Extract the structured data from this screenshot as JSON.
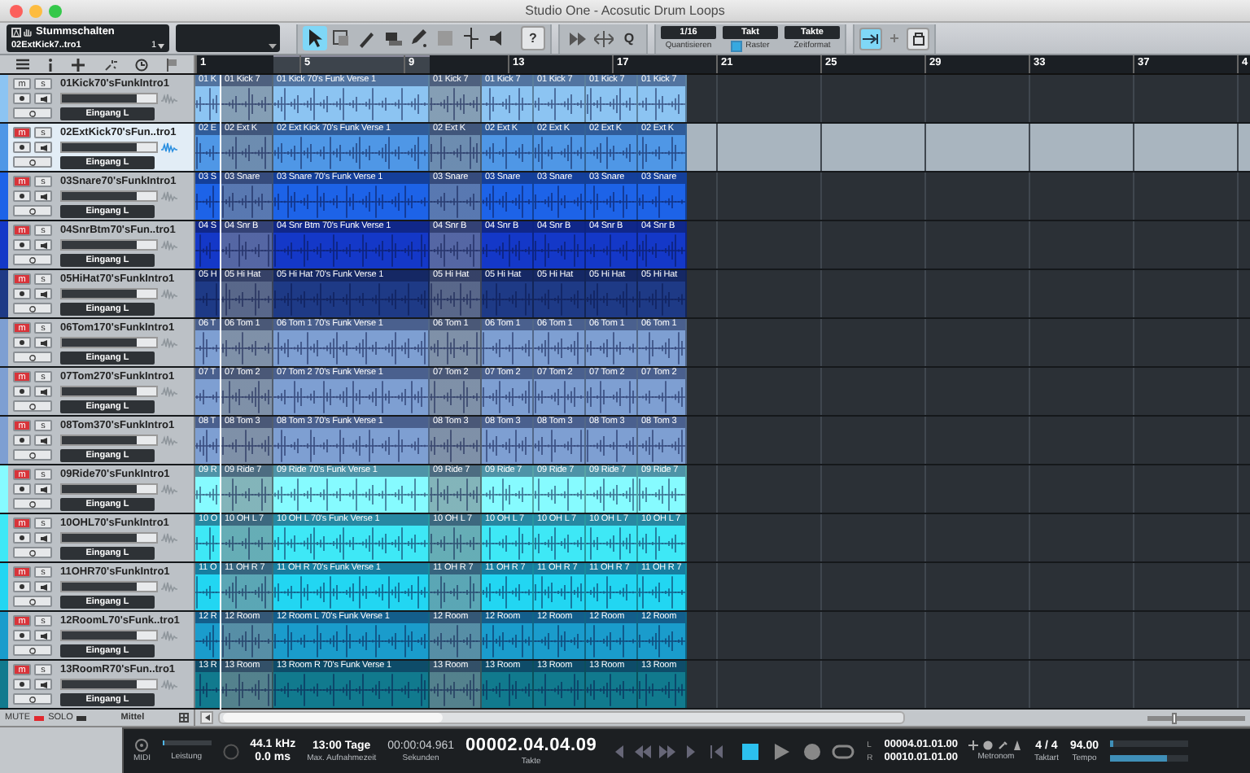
{
  "window": {
    "title": "Studio One - Acosutic Drum Loops"
  },
  "toolbar": {
    "track_panel": {
      "title": "Stummschalten",
      "track": "02ExtKick7..tro1",
      "number": "1"
    },
    "tools": [
      {
        "kind": "arrow",
        "selected": true
      },
      {
        "kind": "range",
        "selected": false
      },
      {
        "kind": "split",
        "selected": false
      },
      {
        "kind": "eraser",
        "selected": false
      },
      {
        "kind": "pencil",
        "selected": false
      },
      {
        "kind": "mute",
        "selected": false
      },
      {
        "kind": "bend",
        "selected": false
      },
      {
        "kind": "listen",
        "selected": false
      }
    ],
    "help_button": "?",
    "quantize_button": "Q",
    "quantize": {
      "value": "1/16",
      "label": "Quantisieren"
    },
    "timebase": {
      "value": "Takt",
      "label": "Raster",
      "checked": true
    },
    "timeformat": {
      "value": "Takte",
      "label": "Zeitformat"
    },
    "autoscroll": {
      "on": true
    }
  },
  "ruler": {
    "bars": [
      "1",
      "5",
      "9",
      "13",
      "17",
      "21",
      "25",
      "29",
      "33",
      "37",
      "4"
    ]
  },
  "tracks": [
    {
      "name": "01Kick70'sFunkIntro1",
      "color": "#8cc4f2",
      "muted": false,
      "selected": false,
      "mute_button": "m",
      "solo_button": "s",
      "level": 0.8,
      "input": "Eingang L",
      "clips": [
        {
          "label": "01 K",
          "dimmed": false
        },
        {
          "label": "01 Kick 7",
          "dimmed": true
        },
        {
          "label": "01 Kick 70's Funk Verse 1",
          "dimmed": false
        },
        {
          "label": "01 Kick 7",
          "dimmed": true
        },
        {
          "label": "01 Kick 7",
          "dimmed": false
        },
        {
          "label": "01 Kick 7",
          "dimmed": false
        },
        {
          "label": "01 Kick 7",
          "dimmed": false
        },
        {
          "label": "01 Kick 7",
          "dimmed": false
        }
      ]
    },
    {
      "name": "02ExtKick70'sFun..tro1",
      "color": "#4f97e6",
      "muted": true,
      "selected": true,
      "mute_button": "m",
      "solo_button": "s",
      "level": 0.8,
      "input": "Eingang L",
      "clips": [
        {
          "label": "02 E",
          "dimmed": false
        },
        {
          "label": "02 Ext K",
          "dimmed": true
        },
        {
          "label": "02 Ext Kick 70's Funk Verse 1",
          "dimmed": false
        },
        {
          "label": "02 Ext K",
          "dimmed": true
        },
        {
          "label": "02 Ext K",
          "dimmed": false
        },
        {
          "label": "02 Ext K",
          "dimmed": false
        },
        {
          "label": "02 Ext K",
          "dimmed": false
        },
        {
          "label": "02 Ext K",
          "dimmed": false
        }
      ]
    },
    {
      "name": "03Snare70'sFunkIntro1",
      "color": "#1d63e8",
      "muted": true,
      "selected": false,
      "mute_button": "m",
      "solo_button": "s",
      "level": 0.8,
      "input": "Eingang L",
      "clips": [
        {
          "label": "03 S",
          "dimmed": false
        },
        {
          "label": "03 Snare",
          "dimmed": true
        },
        {
          "label": "03 Snare 70's Funk Verse 1",
          "dimmed": false
        },
        {
          "label": "03 Snare",
          "dimmed": true
        },
        {
          "label": "03 Snare",
          "dimmed": false
        },
        {
          "label": "03 Snare",
          "dimmed": false
        },
        {
          "label": "03 Snare",
          "dimmed": false
        },
        {
          "label": "03 Snare",
          "dimmed": false
        }
      ]
    },
    {
      "name": "04SnrBtm70'sFun..tro1",
      "color": "#1438c8",
      "muted": true,
      "selected": false,
      "mute_button": "m",
      "solo_button": "s",
      "level": 0.8,
      "input": "Eingang L",
      "clips": [
        {
          "label": "04 S",
          "dimmed": false
        },
        {
          "label": "04 Snr B",
          "dimmed": true
        },
        {
          "label": "04 Snr Btm 70's Funk Verse 1",
          "dimmed": false
        },
        {
          "label": "04 Snr B",
          "dimmed": true
        },
        {
          "label": "04 Snr B",
          "dimmed": false
        },
        {
          "label": "04 Snr B",
          "dimmed": false
        },
        {
          "label": "04 Snr B",
          "dimmed": false
        },
        {
          "label": "04 Snr B",
          "dimmed": false
        }
      ]
    },
    {
      "name": "05HiHat70'sFunkIntro1",
      "color": "#1e3a86",
      "muted": true,
      "selected": false,
      "mute_button": "m",
      "solo_button": "s",
      "level": 0.8,
      "input": "Eingang L",
      "clips": [
        {
          "label": "05 H",
          "dimmed": false
        },
        {
          "label": "05 Hi Hat",
          "dimmed": true
        },
        {
          "label": "05 Hi Hat 70's Funk Verse 1",
          "dimmed": false
        },
        {
          "label": "05 Hi Hat",
          "dimmed": true
        },
        {
          "label": "05 Hi Hat",
          "dimmed": false
        },
        {
          "label": "05 Hi Hat",
          "dimmed": false
        },
        {
          "label": "05 Hi Hat",
          "dimmed": false
        },
        {
          "label": "05 Hi Hat",
          "dimmed": false
        }
      ]
    },
    {
      "name": "06Tom170'sFunkIntro1",
      "color": "#7e9fd2",
      "muted": true,
      "selected": false,
      "mute_button": "m",
      "solo_button": "s",
      "level": 0.8,
      "input": "Eingang L",
      "clips": [
        {
          "label": "06 T",
          "dimmed": false
        },
        {
          "label": "06 Tom 1",
          "dimmed": true
        },
        {
          "label": "06 Tom 1 70's Funk Verse 1",
          "dimmed": false
        },
        {
          "label": "06 Tom 1",
          "dimmed": true
        },
        {
          "label": "06 Tom 1",
          "dimmed": false
        },
        {
          "label": "06 Tom 1",
          "dimmed": false
        },
        {
          "label": "06 Tom 1",
          "dimmed": false
        },
        {
          "label": "06 Tom 1",
          "dimmed": false
        }
      ]
    },
    {
      "name": "07Tom270'sFunkIntro1",
      "color": "#7e9fd2",
      "muted": true,
      "selected": false,
      "mute_button": "m",
      "solo_button": "s",
      "level": 0.8,
      "input": "Eingang L",
      "clips": [
        {
          "label": "07 T",
          "dimmed": false
        },
        {
          "label": "07 Tom 2",
          "dimmed": true
        },
        {
          "label": "07 Tom 2 70's Funk Verse 1",
          "dimmed": false
        },
        {
          "label": "07 Tom 2",
          "dimmed": true
        },
        {
          "label": "07 Tom 2",
          "dimmed": false
        },
        {
          "label": "07 Tom 2",
          "dimmed": false
        },
        {
          "label": "07 Tom 2",
          "dimmed": false
        },
        {
          "label": "07 Tom 2",
          "dimmed": false
        }
      ]
    },
    {
      "name": "08Tom370'sFunkIntro1",
      "color": "#7e9fd2",
      "muted": true,
      "selected": false,
      "mute_button": "m",
      "solo_button": "s",
      "level": 0.8,
      "input": "Eingang L",
      "clips": [
        {
          "label": "08 T",
          "dimmed": false
        },
        {
          "label": "08 Tom 3",
          "dimmed": true
        },
        {
          "label": "08 Tom 3 70's Funk Verse 1",
          "dimmed": false
        },
        {
          "label": "08 Tom 3",
          "dimmed": true
        },
        {
          "label": "08 Tom 3",
          "dimmed": false
        },
        {
          "label": "08 Tom 3",
          "dimmed": false
        },
        {
          "label": "08 Tom 3",
          "dimmed": false
        },
        {
          "label": "08 Tom 3",
          "dimmed": false
        }
      ]
    },
    {
      "name": "09Ride70'sFunkIntro1",
      "color": "#86fbff",
      "muted": true,
      "selected": false,
      "mute_button": "m",
      "solo_button": "s",
      "level": 0.8,
      "input": "Eingang L",
      "clips": [
        {
          "label": "09 R",
          "dimmed": false
        },
        {
          "label": "09 Ride 7",
          "dimmed": true
        },
        {
          "label": "09 Ride 70's Funk Verse 1",
          "dimmed": false
        },
        {
          "label": "09 Ride 7",
          "dimmed": true
        },
        {
          "label": "09 Ride 7",
          "dimmed": false
        },
        {
          "label": "09 Ride 7",
          "dimmed": false
        },
        {
          "label": "09 Ride 7",
          "dimmed": false
        },
        {
          "label": "09 Ride 7",
          "dimmed": false
        }
      ]
    },
    {
      "name": "10OHL70'sFunkIntro1",
      "color": "#3ee8f6",
      "muted": true,
      "selected": false,
      "mute_button": "m",
      "solo_button": "s",
      "level": 0.8,
      "input": "Eingang L",
      "clips": [
        {
          "label": "10 O",
          "dimmed": false
        },
        {
          "label": "10 OH L 7",
          "dimmed": true
        },
        {
          "label": "10 OH L 70's Funk Verse 1",
          "dimmed": false
        },
        {
          "label": "10 OH L 7",
          "dimmed": true
        },
        {
          "label": "10 OH L 7",
          "dimmed": false
        },
        {
          "label": "10 OH L 7",
          "dimmed": false
        },
        {
          "label": "10 OH L 7",
          "dimmed": false
        },
        {
          "label": "10 OH L 7",
          "dimmed": false
        }
      ]
    },
    {
      "name": "11OHR70'sFunkIntro1",
      "color": "#22d6f2",
      "muted": true,
      "selected": false,
      "mute_button": "m",
      "solo_button": "s",
      "level": 0.8,
      "input": "Eingang L",
      "clips": [
        {
          "label": "11 O",
          "dimmed": false
        },
        {
          "label": "11 OH R 7",
          "dimmed": true
        },
        {
          "label": "11 OH R 70's Funk Verse 1",
          "dimmed": false
        },
        {
          "label": "11 OH R 7",
          "dimmed": true
        },
        {
          "label": "11 OH R 7",
          "dimmed": false
        },
        {
          "label": "11 OH R 7",
          "dimmed": false
        },
        {
          "label": "11 OH R 7",
          "dimmed": false
        },
        {
          "label": "11 OH R 7",
          "dimmed": false
        }
      ]
    },
    {
      "name": "12RoomL70'sFunk..tro1",
      "color": "#1a9ccc",
      "muted": true,
      "selected": false,
      "mute_button": "m",
      "solo_button": "s",
      "level": 0.8,
      "input": "Eingang L",
      "clips": [
        {
          "label": "12 R",
          "dimmed": false
        },
        {
          "label": "12 Room",
          "dimmed": true
        },
        {
          "label": "12 Room L 70's Funk Verse 1",
          "dimmed": false
        },
        {
          "label": "12 Room",
          "dimmed": true
        },
        {
          "label": "12 Room",
          "dimmed": false
        },
        {
          "label": "12 Room",
          "dimmed": false
        },
        {
          "label": "12 Room",
          "dimmed": false
        },
        {
          "label": "12 Room",
          "dimmed": false
        }
      ]
    },
    {
      "name": "13RoomR70'sFun..tro1",
      "color": "#117a8e",
      "muted": true,
      "selected": false,
      "mute_button": "m",
      "solo_button": "s",
      "level": 0.8,
      "input": "Eingang L",
      "clips": [
        {
          "label": "13 R",
          "dimmed": false
        },
        {
          "label": "13 Room",
          "dimmed": true
        },
        {
          "label": "13 Room R 70's Funk Verse 1",
          "dimmed": false
        },
        {
          "label": "13 Room",
          "dimmed": true
        },
        {
          "label": "13 Room",
          "dimmed": false
        },
        {
          "label": "13 Room",
          "dimmed": false
        },
        {
          "label": "13 Room",
          "dimmed": false
        },
        {
          "label": "13 Room",
          "dimmed": false
        }
      ]
    }
  ],
  "bottom_bar": {
    "mute_all": {
      "label": "MUTE",
      "on": true
    },
    "solo_all": {
      "label": "SOLO",
      "on": false
    },
    "size": "Mittel",
    "zoom": {
      "level": 0.25
    }
  },
  "transport": {
    "midi": "MIDI",
    "performance": {
      "label": "Leistung",
      "level": 0.06
    },
    "sample_rate": "44.1 kHz",
    "latency": "0.0 ms",
    "record_time": {
      "value": "13:00 Tage",
      "label": "Max. Aufnahmezeit"
    },
    "seconds": {
      "value": "00:00:04.961",
      "label": "Sekunden"
    },
    "bars": {
      "value": "00002.04.04.09",
      "label": "Takte"
    },
    "stop_active": true,
    "loop_markers": [
      "L",
      "R"
    ],
    "loop_start": "00004.01.01.00",
    "loop_end": "00010.01.01.00",
    "metronome": "Metronom",
    "signature": {
      "value": "4 / 4",
      "label": "Taktart"
    },
    "tempo": {
      "value": "94.00",
      "label": "Tempo"
    },
    "output_meters": [
      {
        "level": 0.05
      },
      {
        "level": 0.72
      }
    ]
  }
}
